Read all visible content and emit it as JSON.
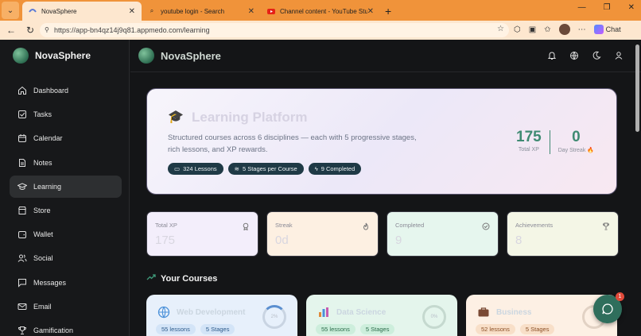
{
  "browser": {
    "tabs": [
      {
        "label": "NovaSphere",
        "active": true,
        "icon": "app-icon"
      },
      {
        "label": "youtube login - Search",
        "active": false,
        "icon": "search-icon"
      },
      {
        "label": "Channel content - YouTube Studio",
        "active": false,
        "icon": "youtube-icon"
      }
    ],
    "url": "https://app-bn4qz14j9q81.appmedo.com/learning",
    "chat_label": "Chat"
  },
  "sidebar": {
    "brand": "NovaSphere",
    "items": [
      {
        "label": "Dashboard",
        "icon": "home-icon",
        "active": false
      },
      {
        "label": "Tasks",
        "icon": "checkbox-icon",
        "active": false
      },
      {
        "label": "Calendar",
        "icon": "calendar-icon",
        "active": false
      },
      {
        "label": "Notes",
        "icon": "notes-icon",
        "active": false
      },
      {
        "label": "Learning",
        "icon": "graduation-cap-icon",
        "active": true
      },
      {
        "label": "Store",
        "icon": "store-icon",
        "active": false
      },
      {
        "label": "Wallet",
        "icon": "wallet-icon",
        "active": false
      },
      {
        "label": "Social",
        "icon": "users-icon",
        "active": false
      },
      {
        "label": "Messages",
        "icon": "message-icon",
        "active": false
      },
      {
        "label": "Email",
        "icon": "mail-icon",
        "active": false
      },
      {
        "label": "Gamification",
        "icon": "trophy-icon",
        "active": false
      }
    ]
  },
  "header": {
    "brand": "NovaSphere",
    "icons": [
      "bell-icon",
      "globe-icon",
      "moon-icon",
      "user-icon"
    ]
  },
  "hero": {
    "title": "Learning Platform",
    "description": "Structured courses across 6 disciplines — each with 5 progressive stages, rich lessons, and XP rewards.",
    "pills": [
      "324 Lessons",
      "5 Stages per Course",
      "9 Completed"
    ],
    "total_xp_value": "175",
    "total_xp_label": "Total XP",
    "day_streak_value": "0",
    "day_streak_label": "Day Streak 🔥"
  },
  "stats": [
    {
      "label": "Total XP",
      "value": "175",
      "icon": "award-icon",
      "bg": "#f3eefb"
    },
    {
      "label": "Streak",
      "value": "0d",
      "icon": "flame-icon",
      "bg": "#fdf0e2"
    },
    {
      "label": "Completed",
      "value": "9",
      "icon": "check-circle-icon",
      "bg": "#e6f6ee"
    },
    {
      "label": "Achievements",
      "value": "8",
      "icon": "trophy-icon",
      "bg": "#f4f6e6"
    }
  ],
  "courses_section": {
    "title": "Your Courses"
  },
  "courses": [
    {
      "title": "Web Development",
      "lessons": "55 lessons",
      "stages": "5 Stages",
      "progress": "2%",
      "icon": "globe-icon",
      "bg": "#e7f0fb"
    },
    {
      "title": "Data Science",
      "lessons": "55 lessons",
      "stages": "5 Stages",
      "progress": "0%",
      "icon": "bar-chart-icon",
      "bg": "#e4f5ec"
    },
    {
      "title": "Business",
      "lessons": "52 lessons",
      "stages": "5 Stages",
      "progress": "",
      "icon": "briefcase-icon",
      "bg": "#fdf0e4"
    }
  ],
  "fab": {
    "badge": "1"
  }
}
